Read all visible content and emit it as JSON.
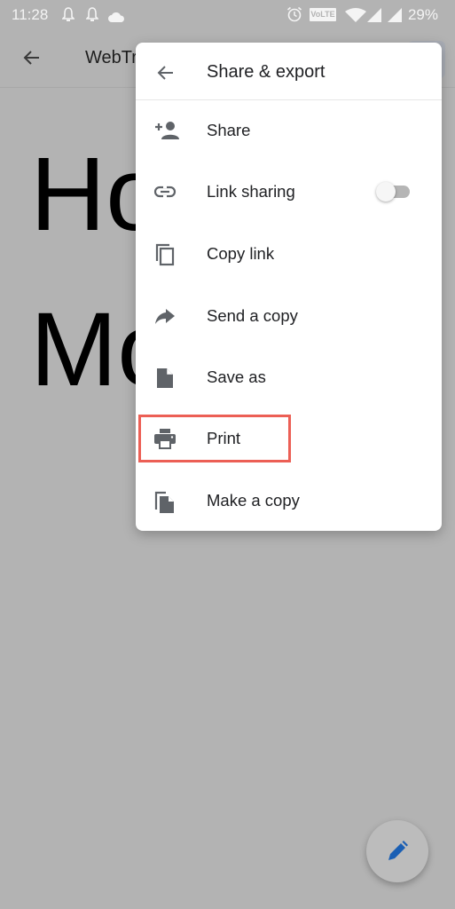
{
  "status_bar": {
    "time": "11:28",
    "volte_label": "VoLTE",
    "battery": "29%",
    "icons": [
      "notification-bell-icon",
      "notification-bell-icon",
      "cloud-icon",
      "alarm-icon",
      "volte-icon",
      "wifi-icon",
      "signal-icon",
      "signal-icon"
    ]
  },
  "app_bar": {
    "back_icon": "arrow-back-icon",
    "title": "WebTr"
  },
  "document": {
    "lines": [
      "Ho",
      "Mo"
    ]
  },
  "share_menu": {
    "title": "Share & export",
    "back_icon": "arrow-back-icon",
    "items": [
      {
        "label": "Share",
        "icon": "person-add-icon"
      },
      {
        "label": "Link sharing",
        "icon": "link-icon",
        "toggle": false
      },
      {
        "label": "Copy link",
        "icon": "copy-icon"
      },
      {
        "label": "Send a copy",
        "icon": "forward-arrow-icon"
      },
      {
        "label": "Save as",
        "icon": "file-icon"
      },
      {
        "label": "Print",
        "icon": "printer-icon",
        "highlighted": true
      },
      {
        "label": "Make a copy",
        "icon": "file-copy-icon"
      }
    ]
  },
  "fab": {
    "icon": "edit-pencil-icon",
    "color": "#1a5fb4"
  },
  "colors": {
    "scrim": "#b3b3b3",
    "highlight_border": "#ec5f55",
    "icon_gray": "#5f6368"
  }
}
